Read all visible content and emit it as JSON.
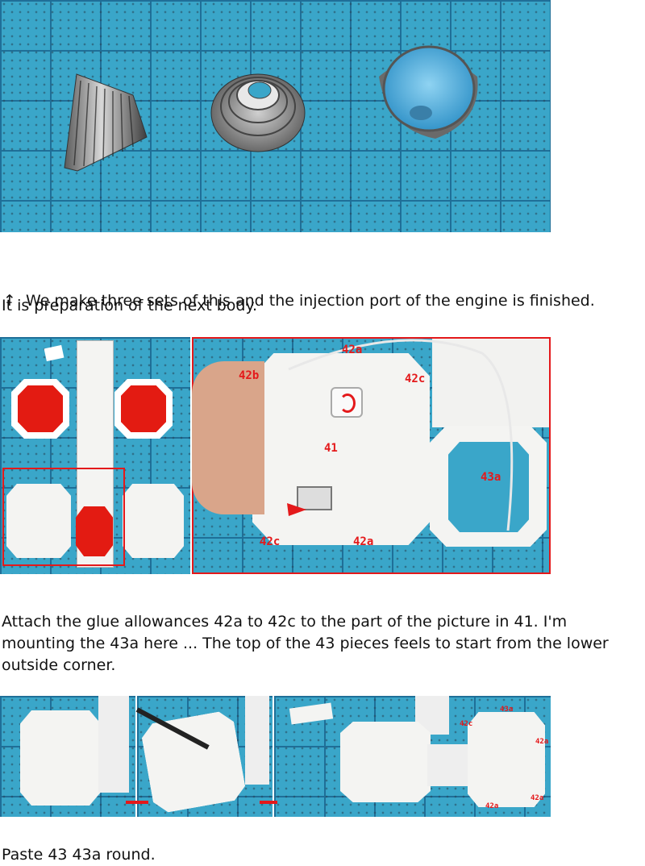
{
  "photos": {
    "engine_parts": {
      "alt": "three cone engine nozzle parts on cutting mat"
    },
    "assembly": {
      "labels": [
        "42a",
        "42b",
        "42c",
        "42c",
        "42a",
        "41",
        "43a"
      ]
    },
    "paste_round": {
      "labels": [
        "43a",
        "42c",
        "42a",
        "42a",
        "42a"
      ]
    }
  },
  "paragraphs": {
    "p1_arrow": "↑",
    "p1": "We make three sets of this and the injection port of the engine is finished.",
    "p1b": "It is preparation of the next body.",
    "p2": "Attach the glue allowances 42a to 42c to the part of the picture in 41. I'm\nmounting the 43a here ... The top of the 43 pieces feels to start from the lower\noutside corner.",
    "p3": "Paste 43 43a round."
  },
  "colors": {
    "mat_blue": "#3aa6c9",
    "grid_line": "#1f6f98",
    "red": "#e4191b",
    "paper": "#f4f4f2"
  }
}
